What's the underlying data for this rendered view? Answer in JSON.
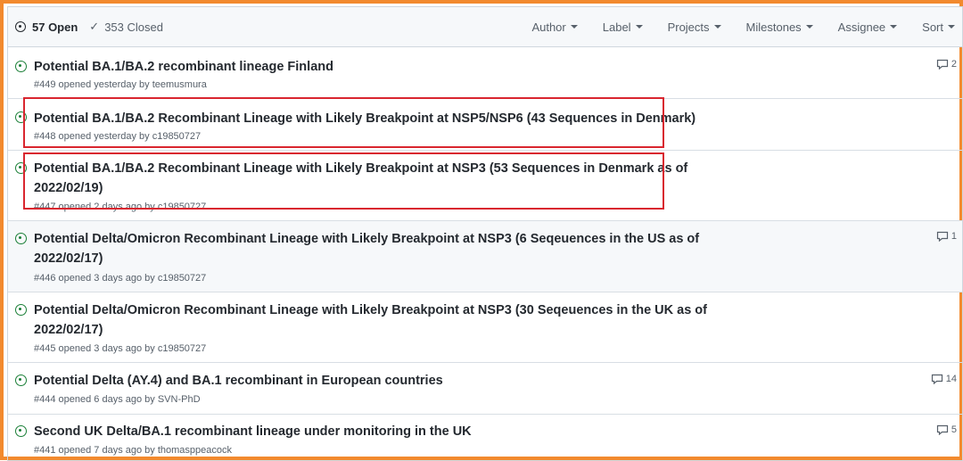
{
  "header": {
    "open_label": "57 Open",
    "closed_label": "353 Closed",
    "filters": [
      "Author",
      "Label",
      "Projects",
      "Milestones",
      "Assignee",
      "Sort"
    ]
  },
  "issues": [
    {
      "title": "Potential BA.1/BA.2 recombinant lineage Finland",
      "meta": "#449 opened yesterday by teemusmura",
      "comments": "2"
    },
    {
      "title": "Potential BA.1/BA.2 Recombinant Lineage with Likely Breakpoint at NSP5/NSP6 (43 Sequences in Denmark)",
      "meta": "#448 opened yesterday by c19850727",
      "comments": ""
    },
    {
      "title_line1": "Potential BA.1/BA.2 Recombinant Lineage with Likely Breakpoint at NSP3 (53 Sequences in Denmark as of",
      "title_line2": "2022/02/19)",
      "meta": "#447 opened 2 days ago by c19850727",
      "comments": ""
    },
    {
      "title_line1": "Potential Delta/Omicron Recombinant Lineage with Likely Breakpoint at NSP3 (6 Seqeuences in the US as of",
      "title_line2": "2022/02/17)",
      "meta": "#446 opened 3 days ago by c19850727",
      "comments": "1"
    },
    {
      "title_line1": "Potential Delta/Omicron Recombinant Lineage with Likely Breakpoint at NSP3 (30 Seqeuences in the UK as of",
      "title_line2": "2022/02/17)",
      "meta": "#445 opened 3 days ago by c19850727",
      "comments": ""
    },
    {
      "title": "Potential Delta (AY.4) and BA.1 recombinant in European countries",
      "meta": "#444 opened 6 days ago by SVN-PhD",
      "comments": "14"
    },
    {
      "title": "Second UK Delta/BA.1 recombinant lineage under monitoring in the UK",
      "meta": "#441 opened 7 days ago by thomasppeacock",
      "comments": "5"
    }
  ],
  "colors": {
    "frame": "#f28a2e",
    "highlight": "#d9262f",
    "open_icon": "#1a7f37"
  }
}
